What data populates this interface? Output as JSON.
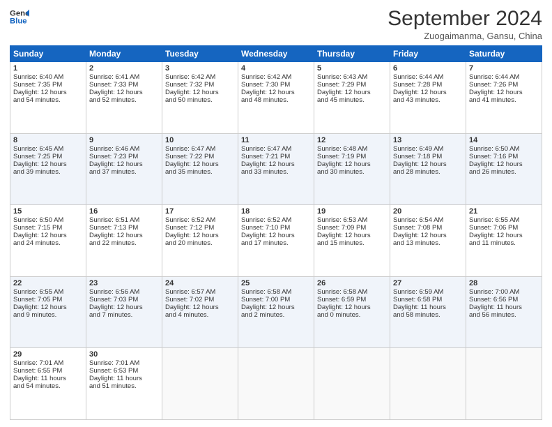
{
  "header": {
    "logo_line1": "General",
    "logo_line2": "Blue",
    "month": "September 2024",
    "location": "Zuogaimanma, Gansu, China"
  },
  "weekdays": [
    "Sunday",
    "Monday",
    "Tuesday",
    "Wednesday",
    "Thursday",
    "Friday",
    "Saturday"
  ],
  "weeks": [
    [
      {
        "day": "1",
        "sunrise": "6:40 AM",
        "sunset": "7:35 PM",
        "hours": "12",
        "mins": "54"
      },
      {
        "day": "2",
        "sunrise": "6:41 AM",
        "sunset": "7:33 PM",
        "hours": "12",
        "mins": "52"
      },
      {
        "day": "3",
        "sunrise": "6:42 AM",
        "sunset": "7:32 PM",
        "hours": "12",
        "mins": "50"
      },
      {
        "day": "4",
        "sunrise": "6:42 AM",
        "sunset": "7:30 PM",
        "hours": "12",
        "mins": "48"
      },
      {
        "day": "5",
        "sunrise": "6:43 AM",
        "sunset": "7:29 PM",
        "hours": "12",
        "mins": "45"
      },
      {
        "day": "6",
        "sunrise": "6:44 AM",
        "sunset": "7:28 PM",
        "hours": "12",
        "mins": "43"
      },
      {
        "day": "7",
        "sunrise": "6:44 AM",
        "sunset": "7:26 PM",
        "hours": "12",
        "mins": "41"
      }
    ],
    [
      {
        "day": "8",
        "sunrise": "6:45 AM",
        "sunset": "7:25 PM",
        "hours": "12",
        "mins": "39"
      },
      {
        "day": "9",
        "sunrise": "6:46 AM",
        "sunset": "7:23 PM",
        "hours": "12",
        "mins": "37"
      },
      {
        "day": "10",
        "sunrise": "6:47 AM",
        "sunset": "7:22 PM",
        "hours": "12",
        "mins": "35"
      },
      {
        "day": "11",
        "sunrise": "6:47 AM",
        "sunset": "7:21 PM",
        "hours": "12",
        "mins": "33"
      },
      {
        "day": "12",
        "sunrise": "6:48 AM",
        "sunset": "7:19 PM",
        "hours": "12",
        "mins": "30"
      },
      {
        "day": "13",
        "sunrise": "6:49 AM",
        "sunset": "7:18 PM",
        "hours": "12",
        "mins": "28"
      },
      {
        "day": "14",
        "sunrise": "6:50 AM",
        "sunset": "7:16 PM",
        "hours": "12",
        "mins": "26"
      }
    ],
    [
      {
        "day": "15",
        "sunrise": "6:50 AM",
        "sunset": "7:15 PM",
        "hours": "12",
        "mins": "24"
      },
      {
        "day": "16",
        "sunrise": "6:51 AM",
        "sunset": "7:13 PM",
        "hours": "12",
        "mins": "22"
      },
      {
        "day": "17",
        "sunrise": "6:52 AM",
        "sunset": "7:12 PM",
        "hours": "12",
        "mins": "20"
      },
      {
        "day": "18",
        "sunrise": "6:52 AM",
        "sunset": "7:10 PM",
        "hours": "12",
        "mins": "17"
      },
      {
        "day": "19",
        "sunrise": "6:53 AM",
        "sunset": "7:09 PM",
        "hours": "12",
        "mins": "15"
      },
      {
        "day": "20",
        "sunrise": "6:54 AM",
        "sunset": "7:08 PM",
        "hours": "12",
        "mins": "13"
      },
      {
        "day": "21",
        "sunrise": "6:55 AM",
        "sunset": "7:06 PM",
        "hours": "12",
        "mins": "11"
      }
    ],
    [
      {
        "day": "22",
        "sunrise": "6:55 AM",
        "sunset": "7:05 PM",
        "hours": "12",
        "mins": "9"
      },
      {
        "day": "23",
        "sunrise": "6:56 AM",
        "sunset": "7:03 PM",
        "hours": "12",
        "mins": "7"
      },
      {
        "day": "24",
        "sunrise": "6:57 AM",
        "sunset": "7:02 PM",
        "hours": "12",
        "mins": "4"
      },
      {
        "day": "25",
        "sunrise": "6:58 AM",
        "sunset": "7:00 PM",
        "hours": "12",
        "mins": "2"
      },
      {
        "day": "26",
        "sunrise": "6:58 AM",
        "sunset": "6:59 PM",
        "hours": "12",
        "mins": "0"
      },
      {
        "day": "27",
        "sunrise": "6:59 AM",
        "sunset": "6:58 PM",
        "hours": "11",
        "mins": "58"
      },
      {
        "day": "28",
        "sunrise": "7:00 AM",
        "sunset": "6:56 PM",
        "hours": "11",
        "mins": "56"
      }
    ],
    [
      {
        "day": "29",
        "sunrise": "7:01 AM",
        "sunset": "6:55 PM",
        "hours": "11",
        "mins": "54"
      },
      {
        "day": "30",
        "sunrise": "7:01 AM",
        "sunset": "6:53 PM",
        "hours": "11",
        "mins": "51"
      },
      null,
      null,
      null,
      null,
      null
    ]
  ]
}
